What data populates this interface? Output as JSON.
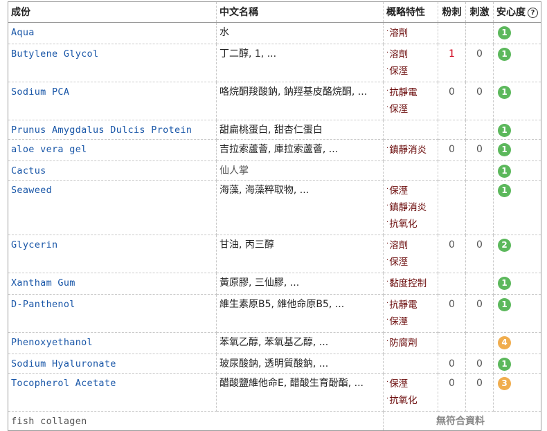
{
  "header": {
    "ingredient": "成份",
    "chinese_name": "中文名稱",
    "properties": "概略特性",
    "acne": "粉刺",
    "irritation": "刺激",
    "safety": "安心度",
    "help_symbol": "?"
  },
  "colors": {
    "link": "#1a57a8",
    "property": "#6a0a0a",
    "acne_red": "#d0021b",
    "safe_green": "#5cb85c",
    "safe_orange": "#f0ad4e"
  },
  "rows": [
    {
      "ingredient": "Aqua",
      "chinese_name": "水",
      "properties": [
        "溶劑"
      ],
      "acne": "",
      "irritation": "",
      "safety": "1"
    },
    {
      "ingredient": "Butylene Glycol",
      "chinese_name": "丁二醇, 1, ...",
      "properties": [
        "溶劑",
        "保溼"
      ],
      "acne": "1",
      "irritation": "0",
      "safety": "1"
    },
    {
      "ingredient": "Sodium PCA",
      "chinese_name": "咯烷酮羧酸鈉, 鈉羥基皮酪烷酮, ...",
      "properties": [
        "抗靜電",
        "保溼"
      ],
      "acne": "0",
      "irritation": "0",
      "safety": "1"
    },
    {
      "ingredient": "Prunus Amygdalus Dulcis Protein",
      "chinese_name": "甜扁桃蛋白, 甜杏仁蛋白",
      "properties": [],
      "acne": "",
      "irritation": "",
      "safety": "1"
    },
    {
      "ingredient": "aloe vera gel",
      "chinese_name": "吉拉索蘆薈, 庫拉索蘆薈, ...",
      "properties": [
        "鎮靜消炎"
      ],
      "acne": "0",
      "irritation": "0",
      "safety": "1"
    },
    {
      "ingredient": "Cactus",
      "chinese_name": "仙人掌",
      "properties": [],
      "acne": "",
      "irritation": "",
      "safety": "1"
    },
    {
      "ingredient": "Seaweed",
      "chinese_name": "海藻, 海藻粹取物, ...",
      "properties": [
        "保溼",
        "鎮靜消炎",
        "抗氧化"
      ],
      "acne": "",
      "irritation": "",
      "safety": "1"
    },
    {
      "ingredient": "Glycerin",
      "chinese_name": "甘油, 丙三醇",
      "properties": [
        "溶劑",
        "保溼"
      ],
      "acne": "0",
      "irritation": "0",
      "safety": "2"
    },
    {
      "ingredient": "Xantham Gum",
      "chinese_name": "黃原膠, 三仙膠, ...",
      "properties": [
        "黏度控制"
      ],
      "acne": "",
      "irritation": "",
      "safety": "1"
    },
    {
      "ingredient": "D-Panthenol",
      "chinese_name": "維生素原B5, 維他命原B5, ...",
      "properties": [
        "抗靜電",
        "保溼"
      ],
      "acne": "0",
      "irritation": "0",
      "safety": "1"
    },
    {
      "ingredient": "Phenoxyethanol",
      "chinese_name": "苯氧乙醇, 苯氧基乙醇, ...",
      "properties": [
        "防腐劑"
      ],
      "acne": "",
      "irritation": "",
      "safety": "4"
    },
    {
      "ingredient": "Sodium Hyaluronate",
      "chinese_name": "玻尿酸鈉, 透明質酸鈉, ...",
      "properties": [],
      "acne": "0",
      "irritation": "0",
      "safety": "1"
    },
    {
      "ingredient": "Tocopherol Acetate",
      "chinese_name": "醋酸鹽維他命E, 醋酸生育酚酯, ...",
      "properties": [
        "保溼",
        "抗氧化"
      ],
      "acne": "0",
      "irritation": "0",
      "safety": "3"
    }
  ],
  "unmatched": {
    "ingredient": "fish collagen",
    "message": "無符合資料"
  }
}
